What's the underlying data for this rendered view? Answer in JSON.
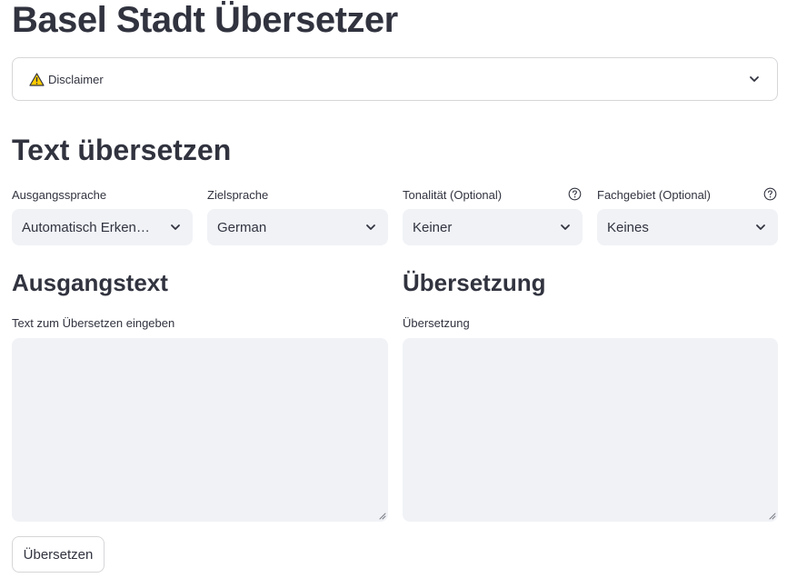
{
  "page": {
    "title": "Basel Stadt Übersetzer"
  },
  "disclaimer": {
    "label": "Disclaimer",
    "icon": "warning-icon"
  },
  "section": {
    "title": "Text übersetzen"
  },
  "selects": {
    "source_lang": {
      "label": "Ausgangssprache",
      "value": "Automatisch Erken…"
    },
    "target_lang": {
      "label": "Zielsprache",
      "value": "German"
    },
    "tone": {
      "label": "Tonalität (Optional)",
      "value": "Keiner"
    },
    "domain": {
      "label": "Fachgebiet (Optional)",
      "value": "Keines"
    }
  },
  "source": {
    "heading": "Ausgangstext",
    "label": "Text zum Übersetzen eingeben",
    "value": ""
  },
  "target": {
    "heading": "Übersetzung",
    "label": "Übersetzung",
    "value": ""
  },
  "actions": {
    "translate_label": "Übersetzen"
  },
  "colors": {
    "text": "#31333f",
    "input_bg": "#f0f2f6",
    "border": "#d6d6d9",
    "warning": "#ffcc00"
  }
}
